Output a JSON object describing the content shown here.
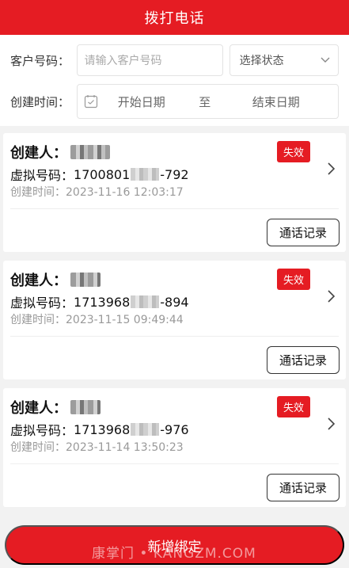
{
  "header": {
    "title": "拨打电话"
  },
  "filter": {
    "customer_label": "客户号码：",
    "customer_placeholder": "请输入客户号码",
    "status_select": "选择状态",
    "created_label": "创建时间：",
    "start_date": "开始日期",
    "date_separator": "至",
    "end_date": "结束日期"
  },
  "records": [
    {
      "creator_label": "创建人：",
      "phone_label": "虚拟号码：",
      "phone_prefix": "1700801",
      "phone_suffix": "-792",
      "time_label": "创建时间：",
      "time": "2023-11-16 12:03:17",
      "status": "失效",
      "button": "通话记录"
    },
    {
      "creator_label": "创建人：",
      "phone_label": "虚拟号码：",
      "phone_prefix": "1713968",
      "phone_suffix": "-894",
      "time_label": "创建时间：",
      "time": "2023-11-15 09:49:44",
      "status": "失效",
      "button": "通话记录"
    },
    {
      "creator_label": "创建人：",
      "phone_label": "虚拟号码：",
      "phone_prefix": "1713968",
      "phone_suffix": "-976",
      "time_label": "创建时间：",
      "time": "2023-11-14 13:50:23",
      "status": "失效",
      "button": "通话记录"
    }
  ],
  "bottom_button": "新增绑定",
  "watermark": "康掌门 • KANGZM.COM",
  "colors": {
    "accent": "#e51c23"
  },
  "icons": {
    "calendar": "calendar-icon",
    "select": "chevron-down-icon",
    "detail": "chevron-right-icon"
  }
}
